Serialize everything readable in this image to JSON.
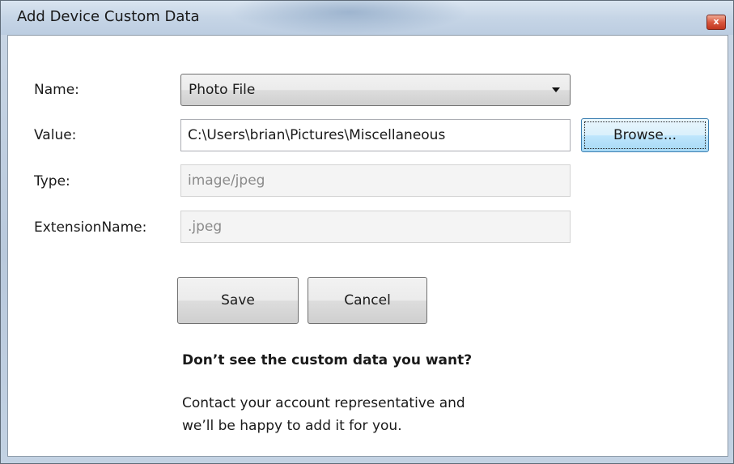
{
  "window": {
    "title": "Add Device Custom Data",
    "close_glyph": "x"
  },
  "form": {
    "name_label": "Name:",
    "name_value": "Photo File",
    "value_label": "Value:",
    "value_value": "C:\\Users\\brian\\Pictures\\Miscellaneous",
    "browse_label": "Browse...",
    "type_label": "Type:",
    "type_value": "image/jpeg",
    "extension_label": "ExtensionName:",
    "extension_value": ".jpeg"
  },
  "actions": {
    "save_label": "Save",
    "cancel_label": "Cancel"
  },
  "help": {
    "heading": "Don’t see the custom data you want?",
    "line1": "Contact your account representative and",
    "line2": "we’ll be happy to add it for you."
  }
}
